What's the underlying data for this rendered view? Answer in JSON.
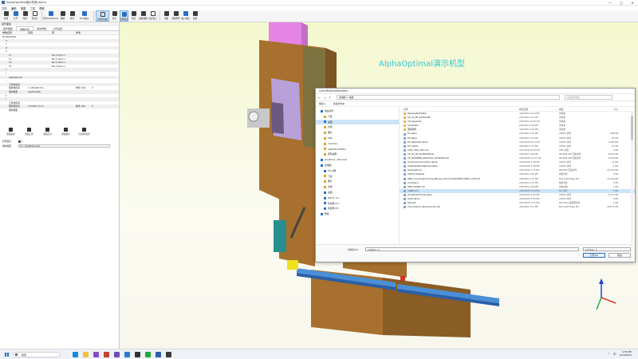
{
  "window": {
    "title": "AlphaOptimal演示机型.alpha",
    "controls": [
      "—",
      "□",
      "✕"
    ]
  },
  "menu": [
    "文件",
    "编辑",
    "视图",
    "工具",
    "帮助"
  ],
  "toolbar": [
    {
      "label": "新建",
      "icon": "file-new-icon"
    },
    {
      "label": "打开",
      "icon": "folder-open-icon"
    },
    {
      "label": "保存",
      "icon": "save-icon"
    },
    {
      "label": "另存为",
      "icon": "save-as-icon"
    },
    {
      "label": "导出SolidWorks",
      "icon": "export-icon",
      "wide": true
    },
    {
      "label": "播放",
      "icon": "play-icon"
    },
    {
      "label": "暂停",
      "icon": "pause-icon"
    },
    {
      "label": "PLC/运动",
      "icon": "plc-icon",
      "wide": true
    },
    {
      "label": "添加运动副",
      "icon": "joint-icon",
      "wide": true,
      "active": true
    },
    {
      "label": "显示",
      "icon": "eye-icon"
    },
    {
      "label": "选择模式",
      "icon": "select-icon",
      "active": true
    },
    {
      "label": "框选",
      "icon": "box-select-icon"
    },
    {
      "label": "缩放视图",
      "icon": "zoom-icon"
    },
    {
      "label": "适应窗口",
      "icon": "fit-icon"
    },
    {
      "label": "测量",
      "icon": "plus-icon"
    },
    {
      "label": "添加零件",
      "icon": "part-icon"
    },
    {
      "label": "输入输出",
      "icon": "io-icon"
    },
    {
      "label": "设置",
      "icon": "settings-icon"
    }
  ],
  "left_panel": {
    "title": "操作面板",
    "tabs": [
      "操作面板",
      "参数列表",
      "运动参数",
      "上传设置"
    ],
    "active_tab": 1,
    "columns": [
      "参数名称",
      "名称",
      "值",
      "参考"
    ],
    "rows": [
      {
        "indent": 0,
        "name": "DoubleTable",
        "n": "",
        "v": "",
        "r": "",
        "e": ""
      },
      {
        "indent": 2,
        "name": "X",
        "n": "",
        "v": "",
        "r": "",
        "e": ""
      },
      {
        "indent": 2,
        "name": "Y",
        "n": "",
        "v": "",
        "r": "",
        "e": ""
      },
      {
        "indent": 2,
        "name": "Z",
        "n": "",
        "v": "",
        "r": "",
        "e": ""
      },
      {
        "indent": 2,
        "name": "A",
        "n": "",
        "v": "",
        "r": "",
        "e": ""
      },
      {
        "indent": 4,
        "name": "T1",
        "n": "",
        "v": "No:1 Dia:1 L",
        "r": "",
        "e": ""
      },
      {
        "indent": 4,
        "name": "T2",
        "n": "",
        "v": "No:1 Dia:1 L",
        "r": "",
        "e": ""
      },
      {
        "indent": 4,
        "name": "T3",
        "n": "",
        "v": "No:1 Dia:1 L",
        "r": "",
        "e": ""
      },
      {
        "indent": 4,
        "name": "T4",
        "n": "",
        "v": "No:1 Dia:1 L",
        "r": "",
        "e": ""
      },
      {
        "indent": 2,
        "name": "Y",
        "n": "",
        "v": "",
        "r": "",
        "e": ""
      },
      {
        "indent": 2,
        "name": "I",
        "n": "",
        "v": "",
        "r": "",
        "e": ""
      },
      {
        "indent": 4,
        "name": "sawFixture0",
        "n": "",
        "v": "",
        "r": "",
        "e": ""
      },
      {
        "indent": 2,
        "name": "...",
        "n": "",
        "v": "",
        "r": "",
        "e": ""
      },
      {
        "indent": 4,
        "name": "工件坐标系",
        "n": "",
        "v": "",
        "r": "",
        "e": ""
      },
      {
        "indent": 4,
        "name": "保护坐标系",
        "n": "X:-35.900 Y:0...",
        "v": "",
        "r": "参考 G54",
        "e": "X"
      },
      {
        "indent": 4,
        "name": "保护模型",
        "n": "sawModel0",
        "v": "",
        "r": "",
        "e": ""
      },
      {
        "indent": 2,
        "name": "Y",
        "n": "",
        "v": "",
        "r": "",
        "e": ""
      },
      {
        "indent": 2,
        "name": "I",
        "n": "",
        "v": "",
        "r": "",
        "e": ""
      },
      {
        "indent": 4,
        "name": "工件坐标系",
        "n": "",
        "v": "",
        "r": "",
        "e": ""
      },
      {
        "indent": 4,
        "name": "保护坐标系",
        "n": "X:0.000 Y:0.0...",
        "v": "",
        "r": "参考 G55",
        "e": "X"
      },
      {
        "indent": 4,
        "name": "保护模型",
        "n": "",
        "v": "",
        "r": "",
        "e": ""
      }
    ],
    "actions": [
      "添加机床",
      "添加工件",
      "添加刀具",
      "添加夹具",
      "导出NC程序"
    ],
    "props": [
      {
        "label": "名称显示",
        "value": "1",
        "checkbox": true
      },
      {
        "label": "保护模型",
        "value": "C:\\...\\sawFixture.stl"
      }
    ]
  },
  "viewport": {
    "brand_text": "AlphaOptimal演示机型"
  },
  "dialog": {
    "title": "CheckFixtureTransform",
    "path": "此电脑 > 桌面",
    "search_placeholder": "在桌面中搜索",
    "tools": [
      "组织 ▾",
      "新建文件夹"
    ],
    "sidebar": [
      {
        "label": "快速访问",
        "icon": "star-icon",
        "indent": false
      },
      {
        "label": "下载",
        "icon": "download-icon",
        "indent": true
      },
      {
        "label": "桌面",
        "icon": "desktop-icon",
        "indent": true,
        "selected": true
      },
      {
        "label": "文档",
        "icon": "document-icon",
        "indent": true
      },
      {
        "label": "图片",
        "icon": "picture-icon",
        "indent": true
      },
      {
        "label": "CNC",
        "icon": "folder-icon",
        "indent": true
      },
      {
        "label": "machine",
        "icon": "folder-icon",
        "indent": true
      },
      {
        "label": "sawFixtureEditor",
        "icon": "folder-icon",
        "indent": true
      },
      {
        "label": "源码说明",
        "icon": "folder-icon",
        "indent": true
      },
      {
        "label": "OneDrive - Personal",
        "icon": "cloud-icon",
        "indent": false
      },
      {
        "label": "此电脑",
        "icon": "computer-icon",
        "indent": false
      },
      {
        "label": "3D 对象",
        "icon": "cube-icon",
        "indent": true
      },
      {
        "label": "下载",
        "icon": "download-icon",
        "indent": true
      },
      {
        "label": "图片",
        "icon": "picture-icon",
        "indent": true
      },
      {
        "label": "文档",
        "icon": "document-icon",
        "indent": true
      },
      {
        "label": "桌面",
        "icon": "desktop-icon",
        "indent": true
      },
      {
        "label": "Win11 (C:)",
        "icon": "drive-icon",
        "indent": true
      },
      {
        "label": "新加卷 (D:)",
        "icon": "drive-icon",
        "indent": true
      },
      {
        "label": "新加卷 (E:)",
        "icon": "drive-icon",
        "indent": true
      },
      {
        "label": "网络",
        "icon": "network-icon",
        "indent": false
      }
    ],
    "columns": [
      "名称",
      "修改日期",
      "类型",
      "大小"
    ],
    "files": [
      {
        "name": "Backup20250404",
        "date": "4/9/2025 12:04 PM",
        "type": "文件夹",
        "size": "",
        "kind": "folder"
      },
      {
        "name": "CE_AC_BF_20250208",
        "date": "2/5/2025 4:41 PM",
        "type": "文件夹",
        "size": "",
        "kind": "folder"
      },
      {
        "name": "CE_SawaAdd",
        "date": "2/5/2025 10:49 AM",
        "type": "文件夹",
        "size": "",
        "kind": "folder"
      },
      {
        "name": "Generator",
        "date": "2/5/2025 3:48 PM",
        "type": "文件夹",
        "size": "",
        "kind": "folder"
      },
      {
        "name": "源码说明",
        "date": "4/9/2025 4:28 PM",
        "type": "文件夹",
        "size": "",
        "kind": "folder"
      },
      {
        "name": "E1.alpha",
        "date": "2/5/2025 2:21 PM",
        "type": "ALPHA 文件",
        "size": "666 KB",
        "kind": "doc"
      },
      {
        "name": "E3.alpha",
        "date": "4/9/2025 7:04 PM",
        "type": "ALPHA 文件",
        "size": "87 KB",
        "kind": "doc"
      },
      {
        "name": "E4_SawaAdd.alpha",
        "date": "4/10/2025 9:23 AM",
        "type": "ALPHA 文件",
        "size": "2,994 KB",
        "kind": "doc"
      },
      {
        "name": "E11.alpha",
        "date": "4/9/2025 4:13 PM",
        "type": "ALPHA 文件",
        "size": "41 KB",
        "kind": "doc"
      },
      {
        "name": "AXIS_TWZ_CNC.xml",
        "date": "4/11/2025 8:26 AM",
        "type": "XML 文档",
        "size": "4 KB",
        "kind": "doc"
      },
      {
        "name": "CE_AC_BF_20250208.zip",
        "date": "2/6/2025 2:48 PM",
        "type": "WinRAR ZIP 压缩文件",
        "size": "8,022 KB",
        "kind": "doc"
      },
      {
        "name": "CE_WOODEN_GROUCK1_20250416.zip",
        "date": "4/16/2025 10:51 AM",
        "type": "WinRAR ZIP 压缩文件",
        "size": "2,844 KB",
        "kind": "doc"
      },
      {
        "name": "checkCommunication.alpha",
        "date": "4/10/2025 3:28 PM",
        "type": "ALPHA 文件",
        "size": "11 KB",
        "kind": "doc"
      },
      {
        "name": "DesktopAlphaOptimal.alpha",
        "date": "4/14/2025 2:46 PM",
        "type": "ALPHA 文件",
        "size": "1 KB",
        "kind": "doc"
      },
      {
        "name": "Generator.rar",
        "date": "4/10/2025 1:11 PM",
        "type": "WinRAR 压缩文件",
        "size": "23,132 KB",
        "kind": "doc"
      },
      {
        "name": "GitHub Desktop",
        "date": "4/9/2025 2:59 PM",
        "type": "快捷方式",
        "size": "3 KB",
        "kind": "doc"
      },
      {
        "name": "LINK_Line_Programming_Manual_V01.03.00(240602-0001)_CHT.pdf",
        "date": "4/9/2025 2:43 PM",
        "type": "Microsoft Edge PD...",
        "size": "12,060 KB",
        "kind": "doc"
      },
      {
        "name": "LocalSend",
        "date": "2/5/2025 2:27 PM",
        "type": "快捷方式",
        "size": "2 KB",
        "kind": "doc"
      },
      {
        "name": "OBS_CLOSE*.txt",
        "date": "2/5/2025 2:48 PM",
        "type": "文本文档",
        "size": "1 KB",
        "kind": "doc"
      },
      {
        "name": "rotation.nc",
        "date": "4/16/2025 4:52 PM",
        "type": "NC 文件",
        "size": "1 KB",
        "kind": "doc",
        "selected": true
      },
      {
        "name": "showFixerFixture.alpha",
        "date": "4/16/2025 4:32 PM",
        "type": "ALPHA 文件",
        "size": "5,177 KB",
        "kind": "doc"
      },
      {
        "name": "temp.alpha",
        "date": "4/10/2025 4:56 PM",
        "type": "ALPHA 文件",
        "size": "8 KB",
        "kind": "doc"
      },
      {
        "name": "test.bat",
        "date": "4/15/2025 1:11 PM",
        "type": "Windows 批处理文件",
        "size": "1 KB",
        "kind": "doc"
      },
      {
        "name": "The_Invasion_MechanicsLl.pdf",
        "date": "4/5/2025 3:11 PM",
        "type": "Microsoft Edge PD...",
        "size": "20,671 KB",
        "kind": "doc"
      }
    ],
    "filename_label": "文件名(N):",
    "filename_value": "rotation.nc",
    "filter": "All Files (*)",
    "open_label": "打开(O)",
    "cancel_label": "取消"
  },
  "taskbar": {
    "search_placeholder": "搜索",
    "apps": [
      {
        "name": "edge-icon",
        "color": "#1a8ad8"
      },
      {
        "name": "file-explorer-icon",
        "color": "#f0c040"
      },
      {
        "name": "visual-studio-icon",
        "color": "#8a4cc2"
      },
      {
        "name": "app-red-icon",
        "color": "#c8402b"
      },
      {
        "name": "app-purple-icon",
        "color": "#6b4fb0"
      },
      {
        "name": "vscode-icon",
        "color": "#2a7ad0"
      },
      {
        "name": "app-dark-icon",
        "color": "#333333"
      },
      {
        "name": "wechat-icon",
        "color": "#1eaa3c"
      },
      {
        "name": "app-blue-icon",
        "color": "#2f5fb0"
      },
      {
        "name": "obs-icon",
        "color": "#3a3a3a"
      }
    ],
    "time": "4:55 PM",
    "date": "4/16/2025",
    "lang": "中"
  }
}
